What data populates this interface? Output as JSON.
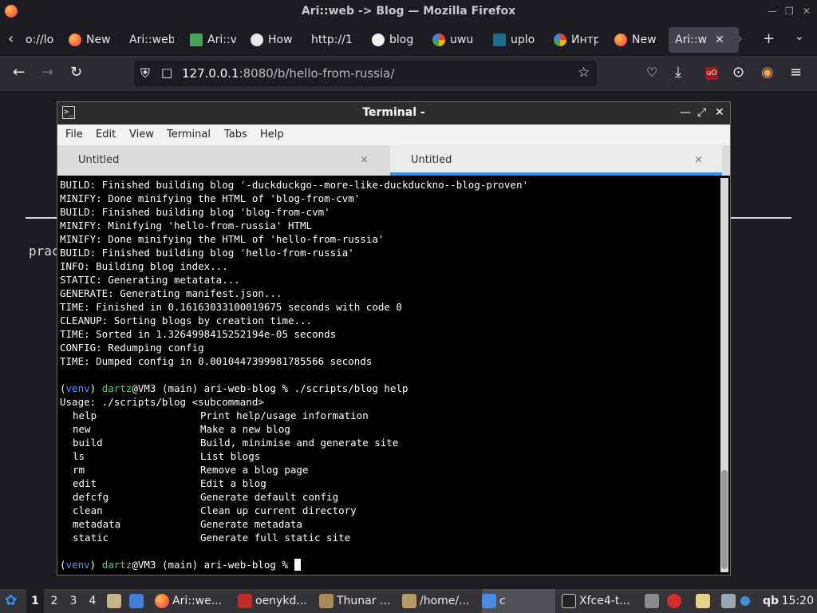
{
  "firefox": {
    "window_title": "Ari::web -> Blog — Mozilla Firefox",
    "window_controls": [
      "—",
      "❒",
      "✕"
    ],
    "tabs": [
      {
        "label": "o://lo",
        "icon": "none"
      },
      {
        "label": "New",
        "icon": "firefox-icon"
      },
      {
        "label": "Ari::web",
        "icon": "none"
      },
      {
        "label": "Ari::v",
        "icon": "puzzle-icon"
      },
      {
        "label": "How",
        "icon": "arch-icon"
      },
      {
        "label": "http://1",
        "icon": "none"
      },
      {
        "label": "blog",
        "icon": "github-icon"
      },
      {
        "label": "uwu",
        "icon": "google-icon"
      },
      {
        "label": "uplo",
        "icon": "shield-icon"
      },
      {
        "label": "Интр",
        "icon": "google-icon"
      },
      {
        "label": "New",
        "icon": "firefox-icon"
      },
      {
        "label": "Ari::w",
        "icon": "none",
        "active": true
      }
    ],
    "tab_close": "✕",
    "url_host": "127.0.0.1",
    "url_rest": ":8080/b/hello-from-russia/"
  },
  "page": {
    "fragment": "prac"
  },
  "terminal": {
    "title": "Terminal -",
    "menu": [
      "File",
      "Edit",
      "View",
      "Terminal",
      "Tabs",
      "Help"
    ],
    "tabs": [
      {
        "label": "Untitled",
        "active": false
      },
      {
        "label": "Untitled",
        "active": true
      }
    ],
    "tab_close": "×",
    "output": [
      "BUILD: Finished building blog '-duckduckgo--more-like-duckduckno--blog-proven'",
      "MINIFY: Done minifying the HTML of 'blog-from-cvm'",
      "BUILD: Finished building blog 'blog-from-cvm'",
      "MINIFY: Minifying 'hello-from-russia' HTML",
      "MINIFY: Done minifying the HTML of 'hello-from-russia'",
      "BUILD: Finished building blog 'hello-from-russia'",
      "INFO: Building blog index...",
      "STATIC: Generating metatata...",
      "GENERATE: Generating manifest.json...",
      "TIME: Finished in 0.16163033100019675 seconds with code 0",
      "CLEANUP: Sorting blogs by creation time...",
      "TIME: Sorted in 1.3264998415252194e-05 seconds",
      "CONFIG: Redumping config",
      "TIME: Dumped config in 0.0010447399981785566 seconds",
      ""
    ],
    "prompt": {
      "venv_open": "(",
      "venv": "venv",
      "venv_close": ")",
      "user": "dartz",
      "host": "@VM3 (main) ari-web-blog % "
    },
    "command": "./scripts/blog help",
    "usage": "Usage: ./scripts/blog <subcommand>",
    "subcommands": [
      {
        "name": "help",
        "desc": "Print help/usage information"
      },
      {
        "name": "new",
        "desc": "Make a new blog"
      },
      {
        "name": "build",
        "desc": "Build, minimise and generate site"
      },
      {
        "name": "ls",
        "desc": "List blogs"
      },
      {
        "name": "rm",
        "desc": "Remove a blog page"
      },
      {
        "name": "edit",
        "desc": "Edit a blog"
      },
      {
        "name": "defcfg",
        "desc": "Generate default config"
      },
      {
        "name": "clean",
        "desc": "Clean up current directory"
      },
      {
        "name": "metadata",
        "desc": "Generate metadata"
      },
      {
        "name": "static",
        "desc": "Generate full static site"
      }
    ]
  },
  "panel": {
    "workspaces": [
      "1",
      "2",
      "3",
      "4"
    ],
    "windows": [
      {
        "label": "Ari::we...",
        "icon": "firefox-icon"
      },
      {
        "label": "oenykd...",
        "icon": "filezilla-icon"
      },
      {
        "label": "Thunar ...",
        "icon": "folder-icon"
      },
      {
        "label": "/home/...",
        "icon": "archive-icon"
      },
      {
        "label": "c",
        "icon": "window-icon"
      },
      {
        "label": "Xfce4-t...",
        "icon": "terminal-icon",
        "focused": true
      }
    ],
    "tray_text": "qb",
    "clock": "15:20"
  }
}
